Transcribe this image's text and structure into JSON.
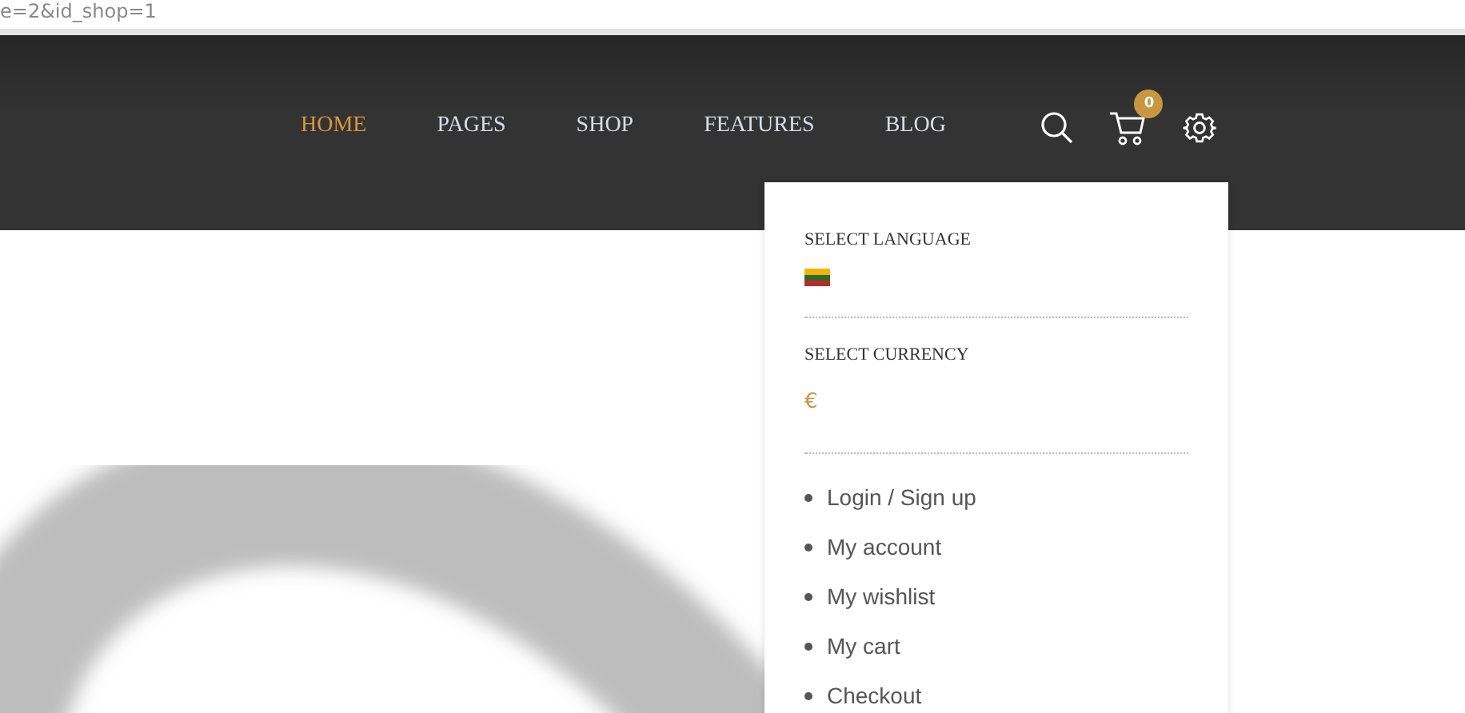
{
  "address_bar": {
    "url": "e=2&id_shop=1"
  },
  "nav": [
    {
      "label": "HOME",
      "selected": true
    },
    {
      "label": "PAGES",
      "selected": false
    },
    {
      "label": "SHOP",
      "selected": false
    },
    {
      "label": "FEATURES",
      "selected": false
    },
    {
      "label": "BLOG",
      "selected": false
    }
  ],
  "cart": {
    "count": "0"
  },
  "dropdown": {
    "language_title": "SELECT LANGUAGE",
    "currency_title": "SELECT CURRENCY",
    "currency": "€",
    "links": [
      "Login / Sign up",
      "My account",
      "My wishlist",
      "My cart",
      "Checkout"
    ]
  }
}
